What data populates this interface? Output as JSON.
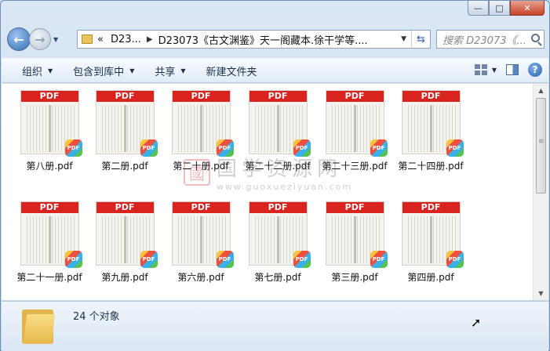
{
  "window": {
    "caption_buttons": {
      "minimize": "—",
      "maximize": "□",
      "close": "✕"
    }
  },
  "address": {
    "overflow": "«",
    "crumbs": [
      "D23...",
      "D23073《古文渊鉴》天一阁藏本.徐干学等...."
    ],
    "search_placeholder": "搜索 D23073《..."
  },
  "toolbar": {
    "organize": "组织",
    "include_in_library": "包含到库中",
    "share": "共享",
    "new_folder": "新建文件夹"
  },
  "files": [
    {
      "name": "第八册.pdf"
    },
    {
      "name": "第二册.pdf"
    },
    {
      "name": "第二十册.pdf"
    },
    {
      "name": "第二十二册.pdf"
    },
    {
      "name": "第二十三册.pdf"
    },
    {
      "name": "第二十四册.pdf"
    },
    {
      "name": "第二十一册.pdf"
    },
    {
      "name": "第九册.pdf"
    },
    {
      "name": "第六册.pdf"
    },
    {
      "name": "第七册.pdf"
    },
    {
      "name": "第三册.pdf"
    },
    {
      "name": "第四册.pdf"
    }
  ],
  "thumb_label": "PDF",
  "badge_label": "PDF",
  "watermark": {
    "seal": "國",
    "text": "国学资源网",
    "url": "www.guoxueziyuan.com"
  },
  "status": {
    "count": "24 个对象"
  }
}
